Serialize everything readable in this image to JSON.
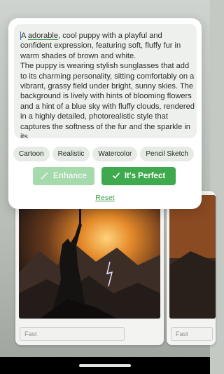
{
  "prompt": {
    "first_word": "A",
    "highlighted_word": "adorable",
    "text": ", cool puppy with a playful and confident expression, featuring soft, fluffy fur in warm shades of brown and white.\nThe puppy is wearing stylish sunglasses that add to its charming personality, sitting comfortably on a vibrant, grassy field under bright, sunny skies. The background is lively with hints of blooming flowers and a hint of a blue sky with fluffy clouds, rendered in a highly detailed, photorealistic style that captures the softness of the fur and the sparkle in its"
  },
  "styles": [
    "Cartoon",
    "Realistic",
    "Watercolor",
    "Pencil Sketch"
  ],
  "buttons": {
    "enhance": "Enhance",
    "perfect": "It's Perfect",
    "reset": "Reset"
  },
  "gallery": {
    "cards": [
      {
        "tag": "Fast"
      },
      {
        "tag": "Fast"
      }
    ]
  },
  "icons": {
    "enhance": "magic-wand-icon",
    "perfect": "checkmark-icon"
  },
  "colors": {
    "accent": "#3fa94d",
    "accent_disabled": "#a6d9ac",
    "chip_bg": "#e6ebe6",
    "prompt_bg": "#eef0ee"
  }
}
